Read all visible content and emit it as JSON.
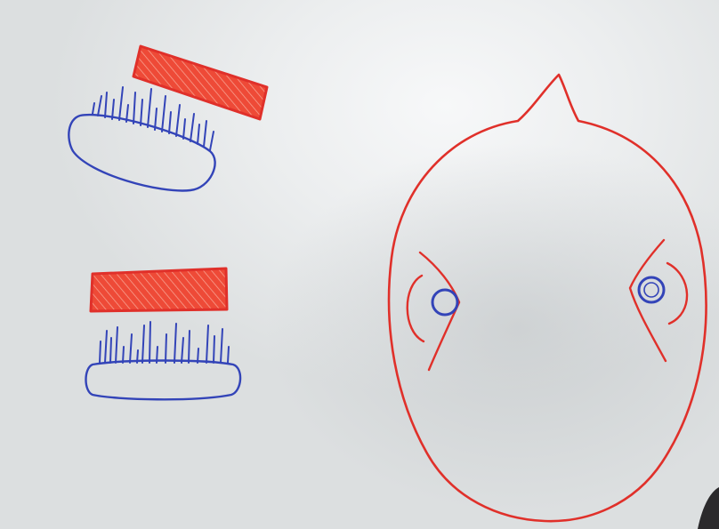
{
  "scene": {
    "subject": "whiteboard-drawing",
    "colors": {
      "board_bright": "#f4f6f7",
      "board_mid": "#e3e6e7",
      "board_shadow": "#c9cdcf",
      "red_marker": "#e0302a",
      "red_fill": "#f0553f",
      "blue_marker": "#3344b8"
    }
  }
}
